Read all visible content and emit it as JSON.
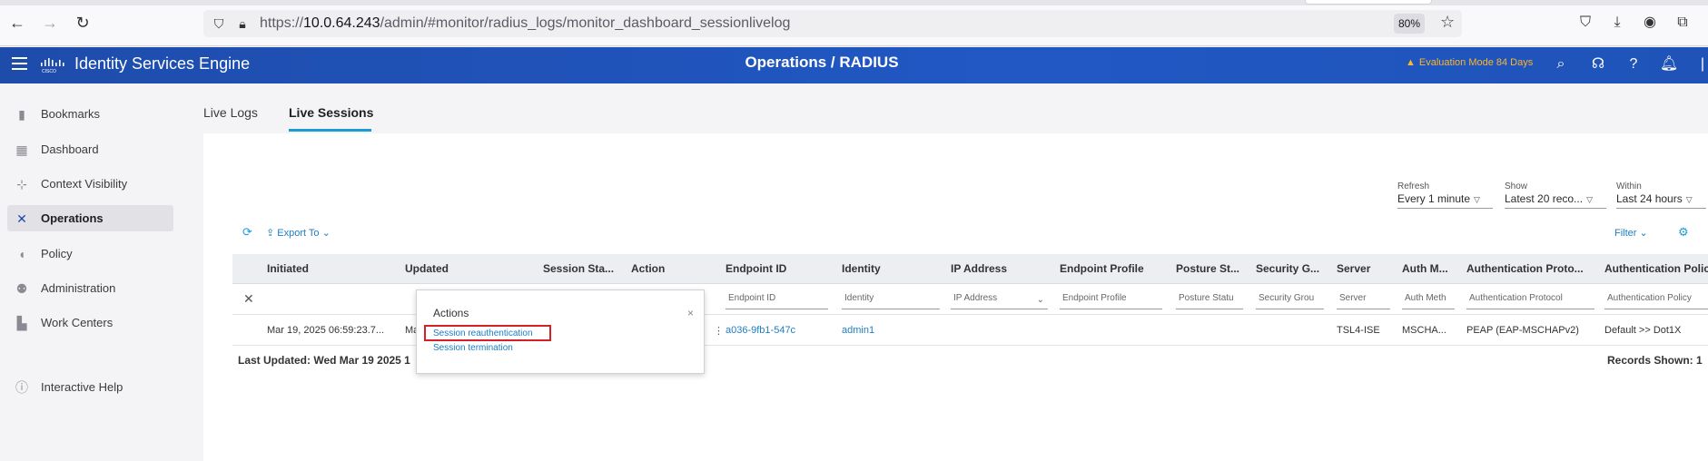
{
  "browser": {
    "url_prefix": "https://",
    "url_host": "10.0.64.243",
    "url_path": "/admin/#monitor/radius_logs/monitor_dashboard_sessionlivelog",
    "zoom": "80%"
  },
  "header": {
    "app_title": "Identity Services Engine",
    "page_title": "Operations / RADIUS",
    "evaluation": "Evaluation Mode 84 Days"
  },
  "sidebar": {
    "items": [
      {
        "label": "Bookmarks",
        "icon": "bookmark-icon"
      },
      {
        "label": "Dashboard",
        "icon": "dashboard-icon"
      },
      {
        "label": "Context Visibility",
        "icon": "context-visibility-icon"
      },
      {
        "label": "Operations",
        "icon": "wrench-icon"
      },
      {
        "label": "Policy",
        "icon": "shield-icon"
      },
      {
        "label": "Administration",
        "icon": "admin-user-icon"
      },
      {
        "label": "Work Centers",
        "icon": "work-centers-icon"
      },
      {
        "label": "Interactive Help",
        "icon": "help-icon"
      }
    ]
  },
  "tabs": [
    {
      "label": "Live Logs"
    },
    {
      "label": "Live Sessions"
    }
  ],
  "controls": {
    "refresh_label": "Refresh",
    "refresh_value": "Every 1 minute",
    "show_label": "Show",
    "show_value": "Latest 20 reco...",
    "within_label": "Within",
    "within_value": "Last 24 hours"
  },
  "toolbar": {
    "export": "Export To",
    "filter": "Filter"
  },
  "table": {
    "headers": [
      "Initiated",
      "Updated",
      "Session Sta...",
      "Action",
      "Endpoint ID",
      "Identity",
      "IP Address",
      "Endpoint Profile",
      "Posture St...",
      "Security G...",
      "Server",
      "Auth M...",
      "Authentication Proto...",
      "Authentication Polic"
    ],
    "filters": {
      "endpoint_id": "Endpoint ID",
      "identity": "Identity",
      "ip_address": "IP Address",
      "endpoint_profile": "Endpoint Profile",
      "posture_status": "Posture Statu",
      "security_group": "Security Grou",
      "server": "Server",
      "auth_method": "Auth Meth",
      "auth_protocol": "Authentication Protocol",
      "auth_policy": "Authentication Policy"
    },
    "row": {
      "initiated": "Mar 19, 2025 06:59:23.7...",
      "updated": "Ma",
      "endpoint_id": "a036-9fb1-547c",
      "identity": "admin1",
      "server": "TSL4-ISE",
      "auth_method": "MSCHA...",
      "auth_protocol": "PEAP (EAP-MSCHAPv2)",
      "auth_policy": "Default >> Dot1X"
    },
    "last_updated": "Last Updated: Wed Mar 19 2025 1",
    "records_shown": "Records Shown: 1"
  },
  "popover": {
    "title": "Actions",
    "close": "×",
    "reauth": "Session reauthentication",
    "termination": "Session termination"
  },
  "colors": {
    "brand_blue": "#1f4fb0",
    "accent": "#1c9bd6",
    "link": "#1c7ec3",
    "warning": "#f7b733",
    "highlight_red": "#d81f26"
  }
}
